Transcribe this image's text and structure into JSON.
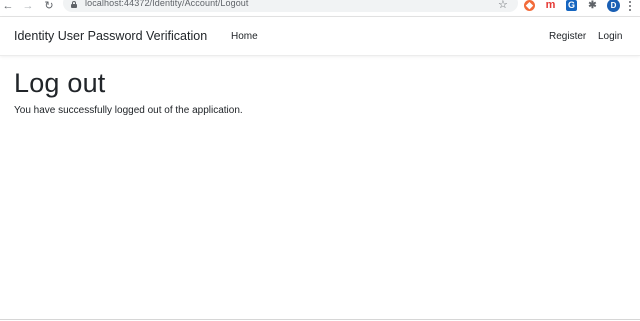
{
  "browser": {
    "url": "localhost:44372/Identity/Account/Logout",
    "back_icon": "←",
    "forward_icon": "→",
    "reload_icon": "↻",
    "star_icon": "☆",
    "extensions": [
      {
        "name": "ext-orange-icon",
        "glyph": "◆"
      },
      {
        "name": "ext-m-icon",
        "glyph": "m"
      },
      {
        "name": "ext-blue-icon",
        "glyph": "G"
      },
      {
        "name": "puzzle-icon",
        "glyph": "✱"
      }
    ],
    "profile_initial": "D"
  },
  "navbar": {
    "brand": "Identity User Password Verification",
    "home": "Home",
    "register": "Register",
    "login": "Login"
  },
  "main": {
    "title": "Log out",
    "message": "You have successfully logged out of the application."
  },
  "colors": {
    "text": "#212529",
    "profile": "#1a5fb4",
    "ext_orange": "#f26b3a",
    "ext_red": "#e53935",
    "ext_blue": "#1565c0"
  }
}
